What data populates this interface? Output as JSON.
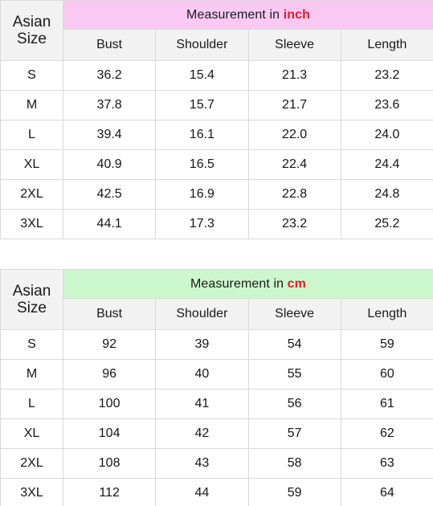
{
  "tables": [
    {
      "id": "inch-table",
      "size_header": "Asian\nSize",
      "size_header_line1": "Asian",
      "size_header_line2": "Size",
      "banner_prefix": "Measurement in ",
      "banner_unit": "inch",
      "banner_color": "#f9c9f2",
      "unit_color": "#e8192e",
      "columns": [
        "Bust",
        "Shoulder",
        "Sleeve",
        "Length"
      ],
      "rows": [
        {
          "size": "S",
          "values": [
            "36.2",
            "15.4",
            "21.3",
            "23.2"
          ]
        },
        {
          "size": "M",
          "values": [
            "37.8",
            "15.7",
            "21.7",
            "23.6"
          ]
        },
        {
          "size": "L",
          "values": [
            "39.4",
            "16.1",
            "22.0",
            "24.0"
          ]
        },
        {
          "size": "XL",
          "values": [
            "40.9",
            "16.5",
            "22.4",
            "24.4"
          ]
        },
        {
          "size": "2XL",
          "values": [
            "42.5",
            "16.9",
            "22.8",
            "24.8"
          ]
        },
        {
          "size": "3XL",
          "values": [
            "44.1",
            "17.3",
            "23.2",
            "25.2"
          ]
        }
      ]
    },
    {
      "id": "cm-table",
      "size_header": "Asian\nSize",
      "size_header_line1": "Asian",
      "size_header_line2": "Size",
      "banner_prefix": "Measurement in ",
      "banner_unit": "cm",
      "banner_color": "#ccf7cc",
      "unit_color": "#e8192e",
      "columns": [
        "Bust",
        "Shoulder",
        "Sleeve",
        "Length"
      ],
      "rows": [
        {
          "size": "S",
          "values": [
            "92",
            "39",
            "54",
            "59"
          ]
        },
        {
          "size": "M",
          "values": [
            "96",
            "40",
            "55",
            "60"
          ]
        },
        {
          "size": "L",
          "values": [
            "100",
            "41",
            "56",
            "61"
          ]
        },
        {
          "size": "XL",
          "values": [
            "104",
            "42",
            "57",
            "62"
          ]
        },
        {
          "size": "2XL",
          "values": [
            "108",
            "43",
            "58",
            "63"
          ]
        },
        {
          "size": "3XL",
          "values": [
            "112",
            "44",
            "59",
            "64"
          ]
        }
      ]
    }
  ]
}
